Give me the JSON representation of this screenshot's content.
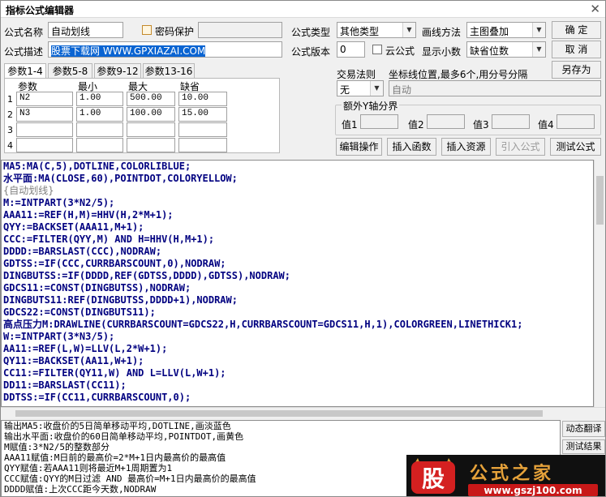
{
  "window": {
    "title": "指标公式编辑器",
    "close_glyph": "✕"
  },
  "form": {
    "name_label": "公式名称",
    "name_value": "自动划线",
    "password_label": "密码保护",
    "desc_label": "公式描述",
    "desc_value": "股票下载网 WWW.GPXIAZAI.COM",
    "type_label": "公式类型",
    "type_value": "其他类型",
    "draw_label": "画线方法",
    "draw_value": "主图叠加",
    "version_label": "公式版本",
    "version_value": "0",
    "cloud_label": "云公式",
    "decimals_label": "显示小数",
    "decimals_value": "缺省位数"
  },
  "buttons": {
    "ok": "确  定",
    "cancel": "取  消",
    "save_as": "另存为",
    "edit_op": "编辑操作",
    "insert_func": "插入函数",
    "insert_res": "插入资源",
    "import_formula": "引入公式",
    "test_formula": "测试公式"
  },
  "tabs": [
    "参数1-4",
    "参数5-8",
    "参数9-12",
    "参数13-16"
  ],
  "params": {
    "headers": [
      "参数",
      "最小",
      "最大",
      "缺省"
    ],
    "rows": [
      {
        "idx": "1",
        "name": "N2",
        "min": "1.00",
        "max": "500.00",
        "def": "10.00"
      },
      {
        "idx": "2",
        "name": "N3",
        "min": "1.00",
        "max": "100.00",
        "def": "15.00"
      },
      {
        "idx": "3",
        "name": "",
        "min": "",
        "max": "",
        "def": ""
      },
      {
        "idx": "4",
        "name": "",
        "min": "",
        "max": "",
        "def": ""
      }
    ]
  },
  "trade": {
    "rule_label": "交易法则",
    "rule_value": "无",
    "coord_label": "坐标线位置,最多6个,用分号分隔",
    "coord_value": "自动",
    "extra_y_label": "额外Y轴分界",
    "value_labels": [
      "值1",
      "值2",
      "值3",
      "值4"
    ]
  },
  "code_lines": [
    "MA5:MA(C,5),DOTLINE,COLORLIBLUE;",
    "水平面:MA(CLOSE,60),POINTDOT,COLORYELLOW;",
    "{自动划线}",
    "M:=INTPART(3*N2/5);",
    "AAA11:=REF(H,M)=HHV(H,2*M+1);",
    "QYY:=BACKSET(AAA11,M+1);",
    "CCC:=FILTER(QYY,M) AND H=HHV(H,M+1);",
    "DDDD:=BARSLAST(CCC),NODRAW;",
    "GDTSS:=IF(CCC,CURRBARSCOUNT,0),NODRAW;",
    "DINGBUTSS:=IF(DDDD,REF(GDTSS,DDDD),GDTSS),NODRAW;",
    "GDCS11:=CONST(DINGBUTSS),NODRAW;",
    "DINGBUTS11:REF(DINGBUTSS,DDDD+1),NODRAW;",
    "GDCS22:=CONST(DINGBUTS11);",
    "高点压力M:DRAWLINE(CURRBARSCOUNT=GDCS22,H,CURRBARSCOUNT=GDCS11,H,1),COLORGREEN,LINETHICK1;",
    "W:=INTPART(3*N3/5);",
    "AA11:=REF(L,W)=LLV(L,2*W+1);",
    "QY11:=BACKSET(AA11,W+1);",
    "CC11:=FILTER(QY11,W) AND L=LLV(L,W+1);",
    "DD11:=BARSLAST(CC11);",
    "DDTSS:=IF(CC11,CURRBARSCOUNT,0);"
  ],
  "output_lines": [
    "输出MA5:收盘价的5日简单移动平均,DOTLINE,画淡蓝色",
    "输出水平面:收盘价的60日简单移动平均,POINTDOT,画黄色",
    "M赋值:3*N2/5的整数部分",
    "AAA11赋值:M日前的最高价=2*M+1日内最高价的最高值",
    "QYY赋值:若AAA11则将最近M+1周期置为1",
    "CCC赋值:QYY的M日过滤 AND 最高价=M+1日内最高价的最高值",
    "DDDD赋值:上次CCC距今天数,NODRAW"
  ],
  "side_buttons": [
    "动态翻译",
    "测试结果"
  ],
  "logo": {
    "char": "股",
    "text": "公式之家",
    "url": "www.gszj100.com"
  }
}
